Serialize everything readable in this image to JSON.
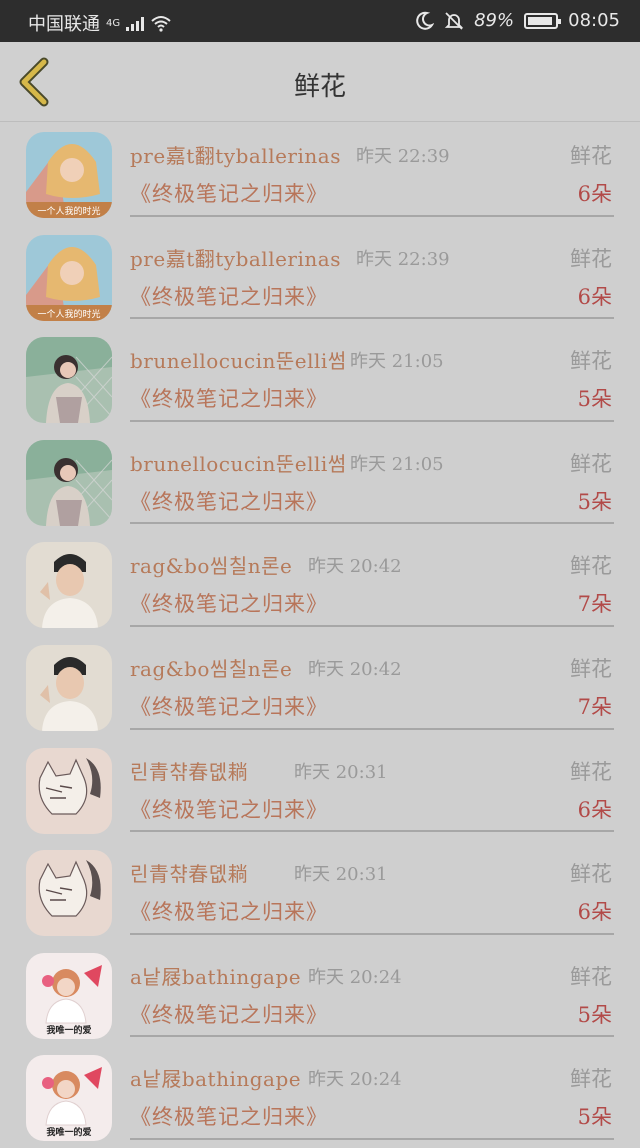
{
  "status_bar": {
    "carrier": "中国联通",
    "network": "4G",
    "battery_percent": "89%",
    "time": "08:05"
  },
  "header": {
    "title": "鲜花"
  },
  "records": [
    {
      "user": "pre嘉t翻tyballerinas",
      "time": "昨天 22:39",
      "gift": "鲜花",
      "book": "《终极笔记之归来》",
      "count": "6朵",
      "avatar": "pink"
    },
    {
      "user": "pre嘉t翻tyballerinas",
      "time": "昨天 22:39",
      "gift": "鲜花",
      "book": "《终极笔记之归来》",
      "count": "6朵",
      "avatar": "pink"
    },
    {
      "user": "brunellocucin뚠elli썸",
      "time": "昨天 21:05",
      "gift": "鲜花",
      "book": "《终极笔记之归来》",
      "count": "5朵",
      "avatar": "girl"
    },
    {
      "user": "brunellocucin뚠elli썸",
      "time": "昨天 21:05",
      "gift": "鲜花",
      "book": "《终极笔记之归来》",
      "count": "5朵",
      "avatar": "girl"
    },
    {
      "user": "rag&bo씸칠n론e",
      "time": "昨天 20:42",
      "gift": "鲜花",
      "book": "《终极笔记之归来》",
      "count": "7朵",
      "avatar": "boy"
    },
    {
      "user": "rag&bo씸칠n론e",
      "time": "昨天 20:42",
      "gift": "鲜花",
      "book": "《终极笔记之归来》",
      "count": "7朵",
      "avatar": "boy"
    },
    {
      "user": "린青챢春뎺耥",
      "time": "昨天 20:31",
      "gift": "鲜花",
      "book": "《终极笔记之归来》",
      "count": "6朵",
      "avatar": "cat"
    },
    {
      "user": "린青챢春뎺耥",
      "time": "昨天 20:31",
      "gift": "鲜花",
      "book": "《终极笔记之归来》",
      "count": "6朵",
      "avatar": "cat"
    },
    {
      "user": "a낱屐bathingape",
      "time": "昨天 20:24",
      "gift": "鲜花",
      "book": "《终极笔记之归来》",
      "count": "5朵",
      "avatar": "love"
    },
    {
      "user": "a낱屐bathingape",
      "time": "昨天 20:24",
      "gift": "鲜花",
      "book": "《终极笔记之归来》",
      "count": "5朵",
      "avatar": "love"
    }
  ],
  "avatar_text": {
    "pink": "一个人我的时光",
    "love": "我唯一的爱"
  },
  "colors": {
    "overlay_bg": "#cfcfcf",
    "username": "#b67a5a",
    "count": "#b24a48",
    "back_arrow": "#d6b84a"
  }
}
